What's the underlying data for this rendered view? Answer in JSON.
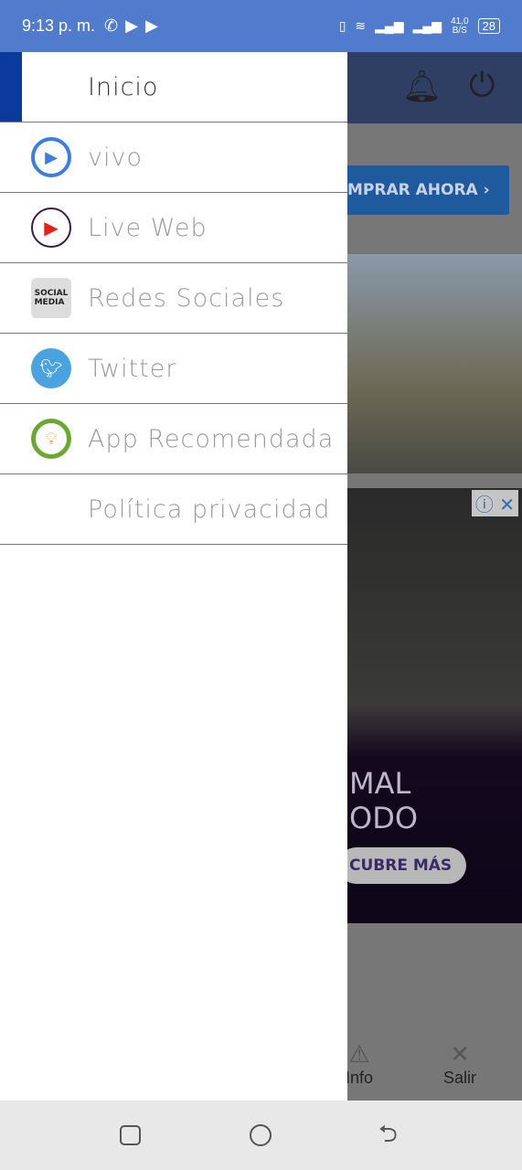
{
  "status_bar": {
    "time": "9:13 p. m.",
    "speed": "41,0",
    "speed_unit": "B/S",
    "battery": "28"
  },
  "background": {
    "buy_button": "MPRAR AHORA ›",
    "ad_line1": "MAL",
    "ad_line2": "ODO",
    "ad_button": "CUBRE MÁS",
    "bottom_nav": [
      {
        "label": "Info",
        "icon": "warning-icon"
      },
      {
        "label": "Salir",
        "icon": "close-icon"
      }
    ]
  },
  "drawer": {
    "items": [
      {
        "label": "Inicio",
        "icon": "none"
      },
      {
        "label": "vivo",
        "icon": "play-circle-icon",
        "color": "#3b7de0"
      },
      {
        "label": "Live Web",
        "icon": "youtube-play-icon",
        "color": "#e62117"
      },
      {
        "label": "Redes Sociales",
        "icon": "social-media-icon"
      },
      {
        "label": "Twitter",
        "icon": "twitter-icon",
        "color": "#4aa3df"
      },
      {
        "label": "App Recomendada",
        "icon": "lightbulb-icon",
        "color": "#6aa832"
      },
      {
        "label": "Política privacidad",
        "icon": "none"
      }
    ]
  }
}
